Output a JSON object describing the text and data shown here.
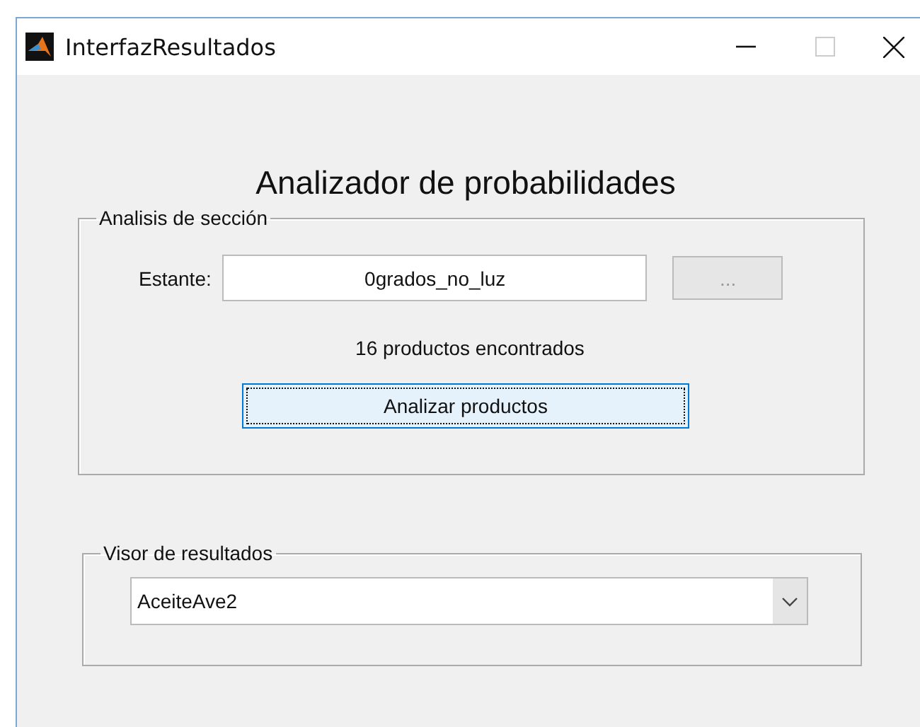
{
  "window": {
    "title": "InterfazResultados"
  },
  "heading": "Analizador de probabilidades",
  "section": {
    "legend": "Analisis de sección",
    "field_label": "Estante:",
    "field_value": "0grados_no_luz",
    "browse": {
      "label": "...",
      "disabled": true
    },
    "status": "16 productos encontrados",
    "analyze": {
      "label": "Analizar productos",
      "focused": true
    }
  },
  "results": {
    "legend": "Visor de resultados",
    "dropdown_value": "AceiteAve2"
  }
}
